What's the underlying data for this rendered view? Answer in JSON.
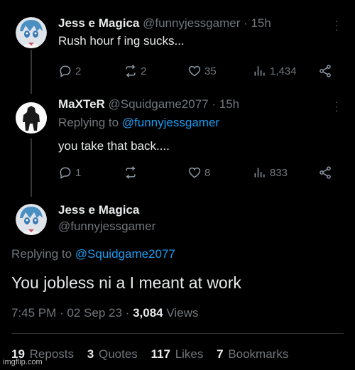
{
  "tweet1": {
    "name": "Jess e Magica",
    "handle": "@funnyjessgamer",
    "time": "· 15h",
    "text": "Rush hour f  ing sucks...",
    "replies": "2",
    "reposts": "2",
    "likes": "35",
    "views": "1,434"
  },
  "tweet2": {
    "name": "MaXTeR",
    "handle": "@Squidgame2077",
    "time": "· 15h",
    "replying_label": "Replying to",
    "replying_to": "@funnyjessgamer",
    "text": "you take that back....",
    "replies": "1",
    "reposts": "",
    "likes": "8",
    "views": "833"
  },
  "tweet3": {
    "name": "Jess e Magica",
    "handle": "@funnyjessgamer",
    "replying_label": "Replying to",
    "replying_to": "@Squidgame2077",
    "text": "You jobless ni  a I meant at work",
    "time": "7:45 PM · 02 Sep 23 ·",
    "views_count": "3,084",
    "views_label": "Views",
    "reposts_count": "19",
    "reposts_label": "Reposts",
    "quotes_count": "3",
    "quotes_label": "Quotes",
    "likes_count": "117",
    "likes_label": "Likes",
    "bookmarks_count": "7",
    "bookmarks_label": "Bookmarks"
  },
  "watermark": "imgflip.com",
  "colors": {
    "background": "#000000",
    "text": "#e7e9ea",
    "muted": "#71767b",
    "link": "#1d9bf0"
  }
}
